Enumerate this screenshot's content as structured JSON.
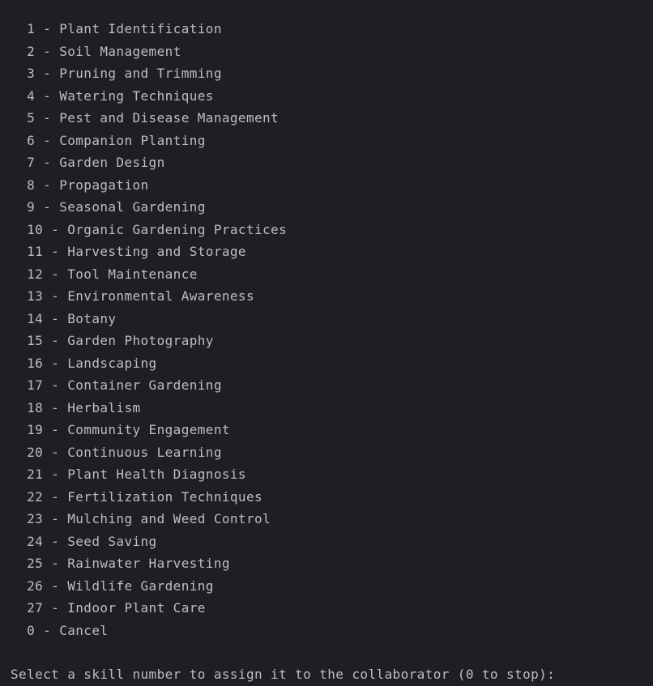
{
  "console": {
    "menu_lines": [
      "  1 - Plant Identification",
      "  2 - Soil Management",
      "  3 - Pruning and Trimming",
      "  4 - Watering Techniques",
      "  5 - Pest and Disease Management",
      "  6 - Companion Planting",
      "  7 - Garden Design",
      "  8 - Propagation",
      "  9 - Seasonal Gardening",
      "  10 - Organic Gardening Practices",
      "  11 - Harvesting and Storage",
      "  12 - Tool Maintenance",
      "  13 - Environmental Awareness",
      "  14 - Botany",
      "  15 - Garden Photography",
      "  16 - Landscaping",
      "  17 - Container Gardening",
      "  18 - Herbalism",
      "  19 - Community Engagement",
      "  20 - Continuous Learning",
      "  21 - Plant Health Diagnosis",
      "  22 - Fertilization Techniques",
      "  23 - Mulching and Weed Control",
      "  24 - Seed Saving",
      "  25 - Rainwater Harvesting",
      "  26 - Wildlife Gardening",
      "  27 - Indoor Plant Care",
      "  0 - Cancel"
    ],
    "prompt": "Select a skill number to assign it to the collaborator (0 to stop):",
    "colors": {
      "background": "#1e1f22",
      "text": "#bcbec4"
    }
  }
}
